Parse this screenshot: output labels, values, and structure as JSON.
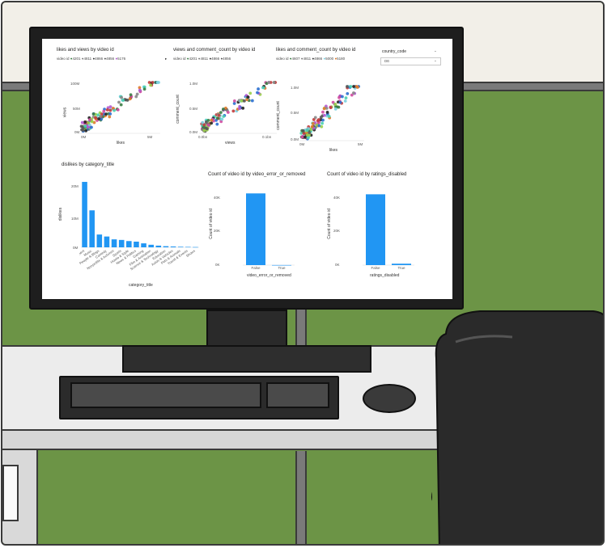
{
  "dashboard": {
    "scatter1": {
      "title": "likes and views by video id",
      "legend": {
        "label": "video id",
        "items": [
          "4201",
          "4811",
          "4866",
          "4856",
          "5176"
        ]
      },
      "xlabel": "likes",
      "ylabel": "views",
      "xticks": [
        "0M",
        "5M"
      ],
      "yticks": [
        "100M",
        "50M",
        "0M"
      ]
    },
    "scatter2": {
      "title": "views and comment_count by video id",
      "legend": {
        "label": "video id",
        "items": [
          "4201",
          "4811",
          "4866",
          "4856",
          "4856"
        ]
      },
      "xlabel": "views",
      "ylabel": "comment_count",
      "xticks": [
        "0.0bn",
        "0.1bn"
      ],
      "yticks": [
        "1.0M",
        "0.5M",
        "0.0M"
      ]
    },
    "scatter3": {
      "title": "likes and comment_count by video id",
      "legend": {
        "label": "video id",
        "items": [
          "4607",
          "4811",
          "4866",
          "5000",
          "5180"
        ]
      },
      "xlabel": "likes",
      "ylabel": "comment_count",
      "xticks": [
        "0M",
        "5M"
      ],
      "yticks": [
        "1.0M",
        "0.5M",
        "0.0M"
      ]
    },
    "slicer": {
      "label": "country_code",
      "value": "DE"
    },
    "bar1": {
      "title": "dislikes by category_title",
      "xlabel": "category_title",
      "ylabel": "dislikes",
      "yticks": [
        "20M",
        "10M",
        "0M"
      ],
      "categories": [
        "Entertainment",
        "Music",
        "People & Blogs",
        "Comedy",
        "Nonprofits & Activism",
        "Sports",
        "Howto & Style",
        "News & Politics",
        "Gaming",
        "Film & Animation",
        "Science & Technology",
        "Education",
        "Autos & Vehicles",
        "Pets & Animals",
        "Travel & Events",
        "Shows"
      ]
    },
    "bar2": {
      "title": "Count of video id by video_error_or_removed",
      "xlabel": "video_error_or_removed",
      "ylabel": "Count of video id",
      "yticks": [
        "40K",
        "20K",
        "0K"
      ],
      "categories": [
        "False",
        "True"
      ]
    },
    "bar3": {
      "title": "Count of video id by ratings_disabled",
      "xlabel": "ratings_disabled",
      "ylabel": "Count of video id",
      "yticks": [
        "40K",
        "20K",
        "0K"
      ],
      "categories": [
        "False",
        "True"
      ]
    },
    "accent": "#2196F3"
  },
  "chart_data": [
    {
      "type": "bar",
      "title": "dislikes by category_title",
      "xlabel": "category_title",
      "ylabel": "dislikes",
      "categories": [
        "Entertainment",
        "Music",
        "People & Blogs",
        "Comedy",
        "Nonprofits & Activism",
        "Sports",
        "Howto & Style",
        "News & Politics",
        "Gaming",
        "Film & Animation",
        "Science & Technology",
        "Education",
        "Autos & Vehicles",
        "Pets & Animals",
        "Travel & Events",
        "Shows"
      ],
      "values": [
        23,
        13,
        4.5,
        3.8,
        2.8,
        2.6,
        2.2,
        2.0,
        1.4,
        0.9,
        0.6,
        0.4,
        0.3,
        0.2,
        0.15,
        0.1
      ],
      "ylim": [
        0,
        25
      ]
    },
    {
      "type": "bar",
      "title": "Count of video id by video_error_or_removed",
      "xlabel": "video_error_or_removed",
      "ylabel": "Count of video id",
      "categories": [
        "False",
        "True"
      ],
      "values": [
        40.5,
        0.05
      ],
      "ylim": [
        0,
        42
      ]
    },
    {
      "type": "bar",
      "title": "Count of video id by ratings_disabled",
      "xlabel": "ratings_disabled",
      "ylabel": "Count of video id",
      "categories": [
        "False",
        "True"
      ],
      "values": [
        40.0,
        0.8
      ],
      "ylim": [
        0,
        42
      ]
    }
  ]
}
